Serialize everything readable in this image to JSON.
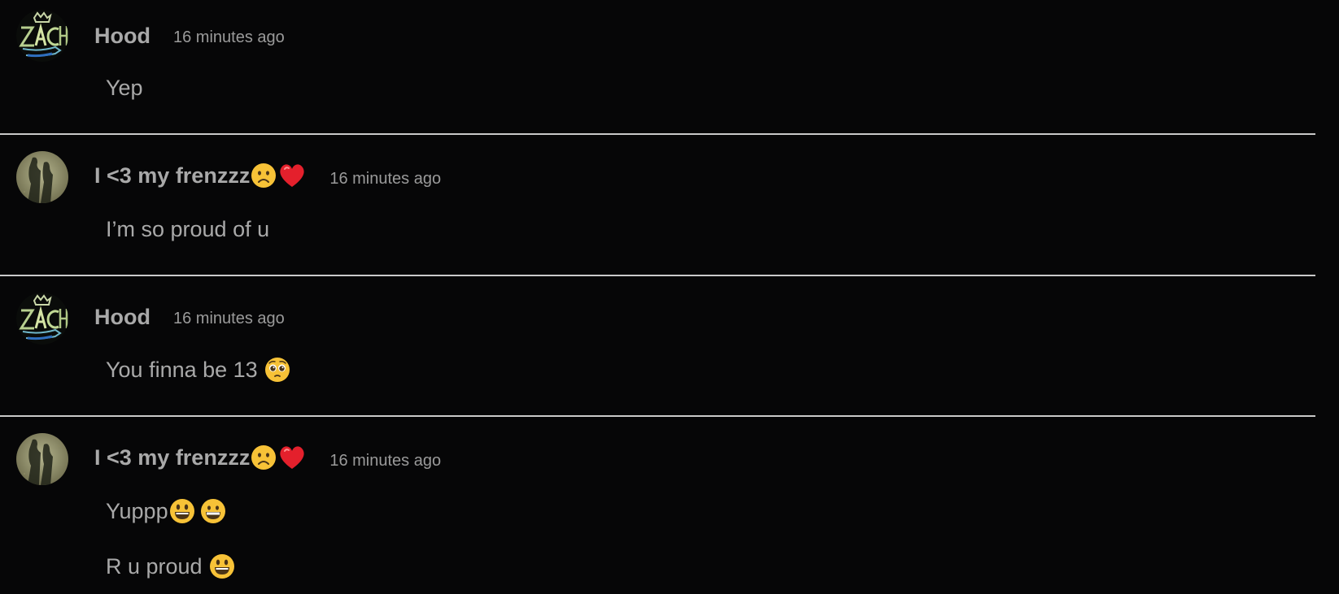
{
  "comments": [
    {
      "username": "Hood",
      "time": "16 minutes ago",
      "messages": [
        "Yep"
      ]
    },
    {
      "username": "I <3 my frenzzz",
      "username_emojis": [
        "frowning-face",
        "red-heart"
      ],
      "time": "16 minutes ago",
      "messages": [
        "I’m so proud of u"
      ]
    },
    {
      "username": "Hood",
      "time": "16 minutes ago",
      "messages": [
        "You finna be 13"
      ],
      "message_emojis": [
        "pleading-face"
      ]
    },
    {
      "username": "I <3 my frenzzz",
      "username_emojis": [
        "frowning-face",
        "red-heart"
      ],
      "time": "16 minutes ago",
      "messages": [
        "Yuppp",
        "R u proud"
      ],
      "message_emojis": [
        [
          "grinning-face-big-eyes",
          "grinning-face"
        ],
        [
          "grinning-face-big-eyes"
        ]
      ]
    }
  ],
  "colors": {
    "background": "#060607",
    "text": "#a9a9a9",
    "divider": "#c9c9c9",
    "emoji_yellow": "#f7c237"
  }
}
